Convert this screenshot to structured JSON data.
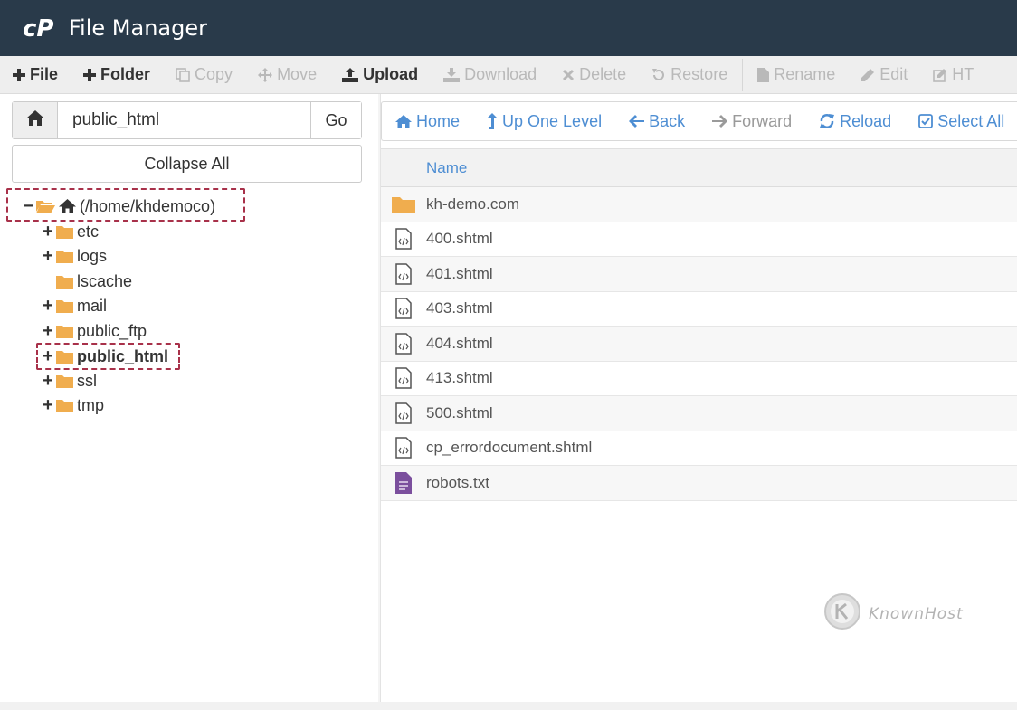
{
  "app": {
    "title": "File Manager"
  },
  "toolbar": {
    "file": "File",
    "folder": "Folder",
    "copy": "Copy",
    "move": "Move",
    "upload": "Upload",
    "download": "Download",
    "delete": "Delete",
    "restore": "Restore",
    "rename": "Rename",
    "edit": "Edit",
    "html_editor": "HT"
  },
  "sidebar": {
    "path_value": "public_html",
    "go_label": "Go",
    "collapse_label": "Collapse All",
    "root_label": "(/home/khdemoco)",
    "items": [
      {
        "label": "etc",
        "has_children": true
      },
      {
        "label": "logs",
        "has_children": true
      },
      {
        "label": "lscache",
        "has_children": false
      },
      {
        "label": "mail",
        "has_children": true
      },
      {
        "label": "public_ftp",
        "has_children": true
      },
      {
        "label": "public_html",
        "has_children": true,
        "selected": true
      },
      {
        "label": "ssl",
        "has_children": true
      },
      {
        "label": "tmp",
        "has_children": true
      }
    ]
  },
  "nav": {
    "home": "Home",
    "up": "Up One Level",
    "back": "Back",
    "forward": "Forward",
    "reload": "Reload",
    "select_all": "Select All"
  },
  "files": {
    "col_name": "Name",
    "rows": [
      {
        "name": "kh-demo.com",
        "icon": "folder-icon"
      },
      {
        "name": "400.shtml",
        "icon": "code-file-icon"
      },
      {
        "name": "401.shtml",
        "icon": "code-file-icon"
      },
      {
        "name": "403.shtml",
        "icon": "code-file-icon"
      },
      {
        "name": "404.shtml",
        "icon": "code-file-icon"
      },
      {
        "name": "413.shtml",
        "icon": "code-file-icon"
      },
      {
        "name": "500.shtml",
        "icon": "code-file-icon"
      },
      {
        "name": "cp_errordocument.shtml",
        "icon": "code-file-icon"
      },
      {
        "name": "robots.txt",
        "icon": "text-file-icon"
      }
    ]
  },
  "watermark": {
    "text": "KnownHost"
  },
  "colors": {
    "header_bg": "#293a4a",
    "accent_blue": "#4e8ed3",
    "folder_orange": "#f0ad4e",
    "highlight_red": "#a8314a",
    "text_file_purple": "#7b4f9d"
  }
}
